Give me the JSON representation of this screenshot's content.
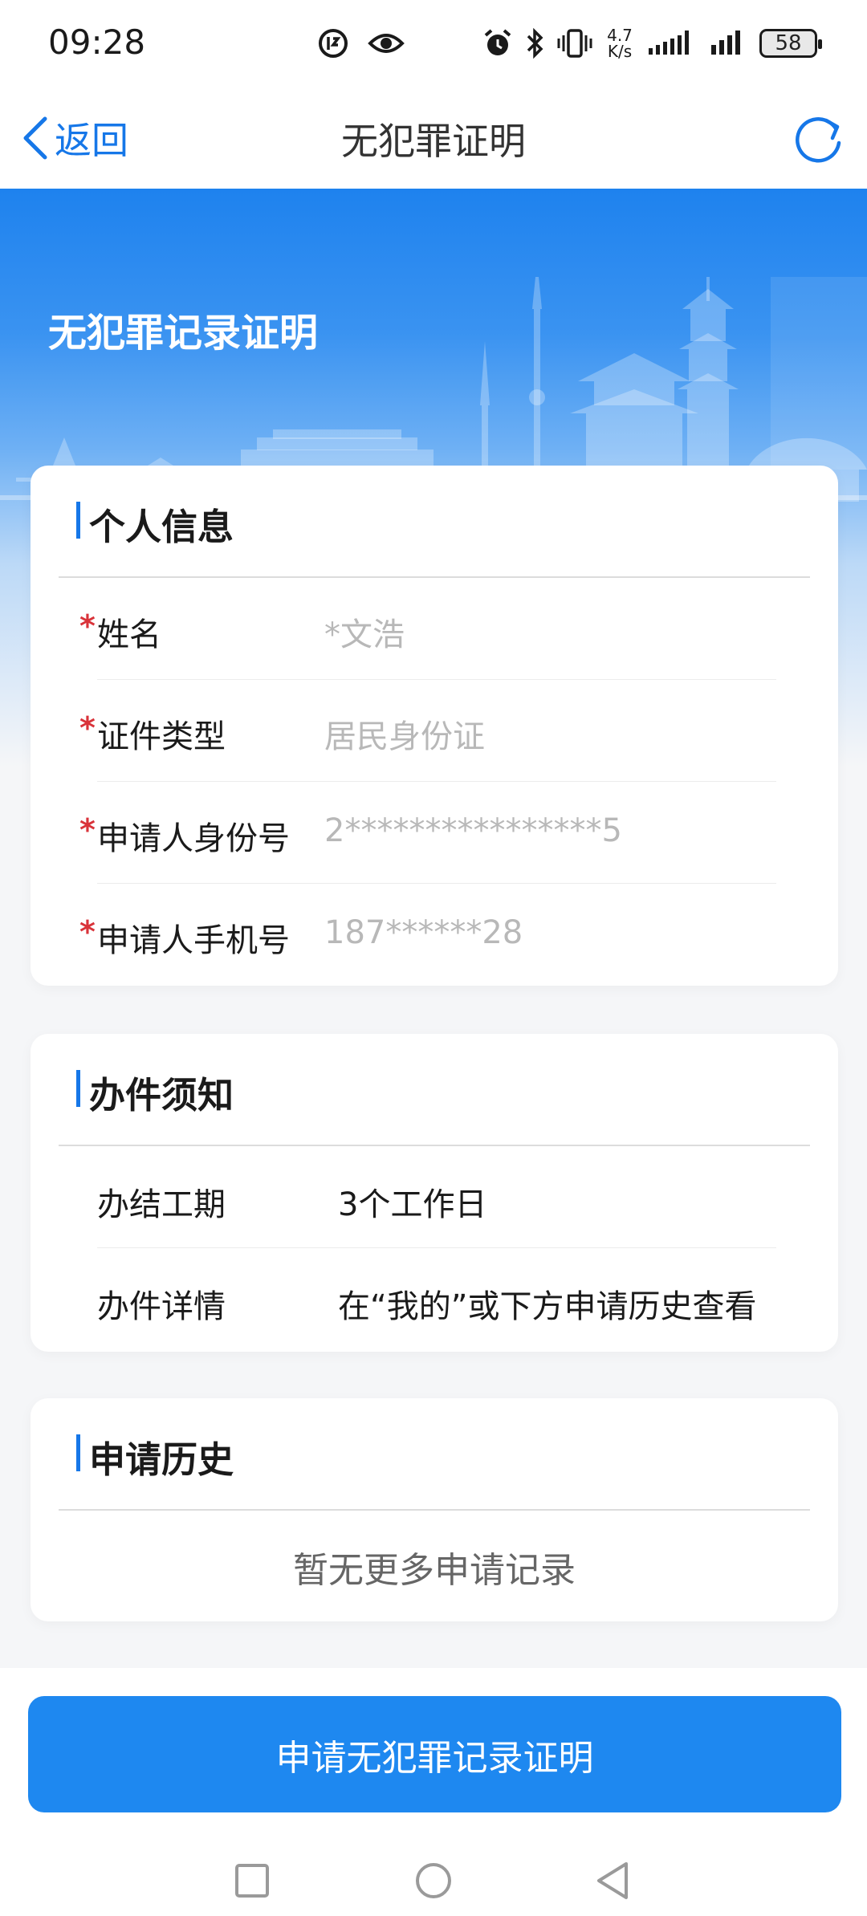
{
  "status_bar": {
    "time": "09:28",
    "net_speed_value": "4.7",
    "net_speed_unit": "K/s",
    "battery": "58",
    "icons": [
      "data-saver-icon",
      "eye-icon",
      "alarm-icon",
      "bluetooth-icon",
      "vibrate-icon",
      "signal-icon",
      "signal-icon",
      "battery-icon"
    ]
  },
  "nav": {
    "back_label": "返回",
    "title": "无犯罪证明",
    "refresh_icon": "refresh-icon"
  },
  "hero": {
    "title": "无犯罪记录证明"
  },
  "personal_info": {
    "title": "个人信息",
    "fields": [
      {
        "label": "姓名",
        "value": "*文浩",
        "required": "*"
      },
      {
        "label": "证件类型",
        "value": "居民身份证",
        "required": "*"
      },
      {
        "label": "申请人身份号",
        "value": "2****************5",
        "required": "*"
      },
      {
        "label": "申请人手机号",
        "value": "187******28",
        "required": "*"
      }
    ]
  },
  "notice": {
    "title": "办件须知",
    "rows": [
      {
        "label": "办结工期",
        "value": "3个工作日"
      },
      {
        "label": "办件详情",
        "value": "在“我的”或下方申请历史查看"
      }
    ]
  },
  "history": {
    "title": "申请历史",
    "empty_text": "暂无更多申请记录"
  },
  "apply_button": "申请无犯罪记录证明",
  "colors": {
    "accent": "#1677e8",
    "button": "#1e88f0",
    "required": "#d9333a"
  }
}
